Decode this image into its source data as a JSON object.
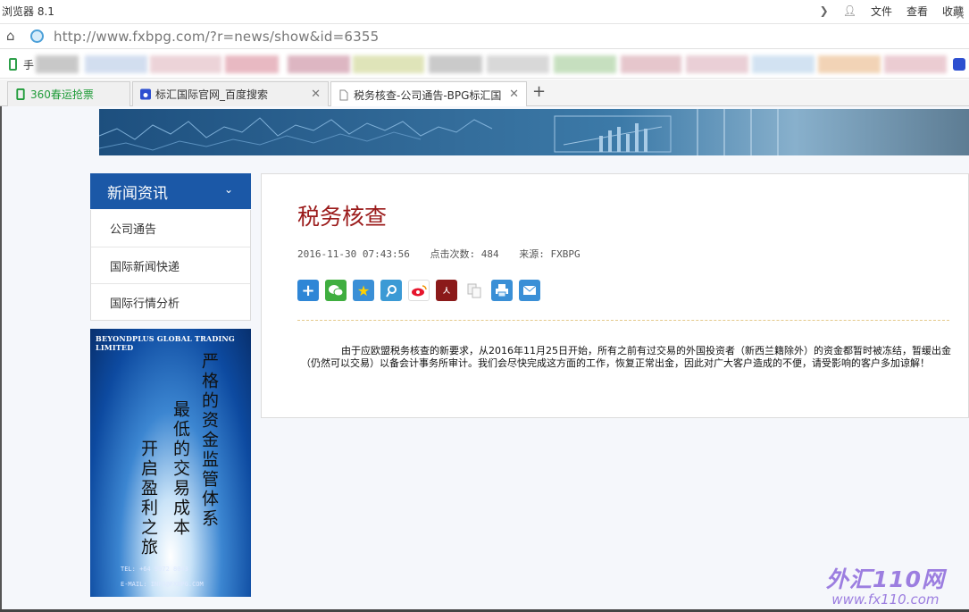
{
  "titlebar": {
    "app_title": "浏览器 8.1",
    "menu_file": "文件",
    "menu_view": "查看",
    "menu_fav": "收藏"
  },
  "address": {
    "url": "http://www.fxbpg.com/?r=news/show&id=6355"
  },
  "bookmarks": {
    "first_label": "手"
  },
  "tabs": [
    {
      "label": "360春运抢票"
    },
    {
      "label": "标汇国际官网_百度搜索"
    },
    {
      "label": "税务核查-公司通告-BPG标汇国"
    }
  ],
  "sidebar": {
    "heading": "新闻资讯",
    "items": [
      {
        "label": "公司通告"
      },
      {
        "label": "国际新闻快递"
      },
      {
        "label": "国际行情分析"
      }
    ]
  },
  "ad": {
    "company": "BEYONDPLUS GLOBAL TRADING LIMITED",
    "line1": "严格的资金监管体系",
    "line2": "最低的交易成本",
    "line3": "开启盈利之旅",
    "tel": "TEL: +64 9972 8043",
    "email": "E-MAIL: INFO@FXBPG.COM"
  },
  "article": {
    "title": "税务核查",
    "date": "2016-11-30 07:43:56",
    "clicks": "点击次数: 484",
    "source": "来源: FXBPG",
    "body": "由于应欧盟税务核查的新要求，从2016年11月25日开始，所有之前有过交易的外国投资者（新西兰籍除外）的资金都暂时被冻结，暂缓出金（仍然可以交易）以备会计事务所审计。我们会尽快完成这方面的工作，恢复正常出金，因此对广大客户造成的不便，请受影响的客户多加谅解！"
  },
  "share_icons": [
    "plus-share-icon",
    "wechat-icon",
    "qzone-icon",
    "tencent-weibo-icon",
    "sina-weibo-icon",
    "renren-icon",
    "copy-icon",
    "print-icon",
    "email-icon"
  ],
  "watermark": {
    "line1": "外汇110网",
    "line2": "www.fx110.com"
  },
  "colors": {
    "sidebar_header": "#1b58a7",
    "article_title": "#9b1b1b",
    "active_tab_text": "#1f9b39"
  }
}
